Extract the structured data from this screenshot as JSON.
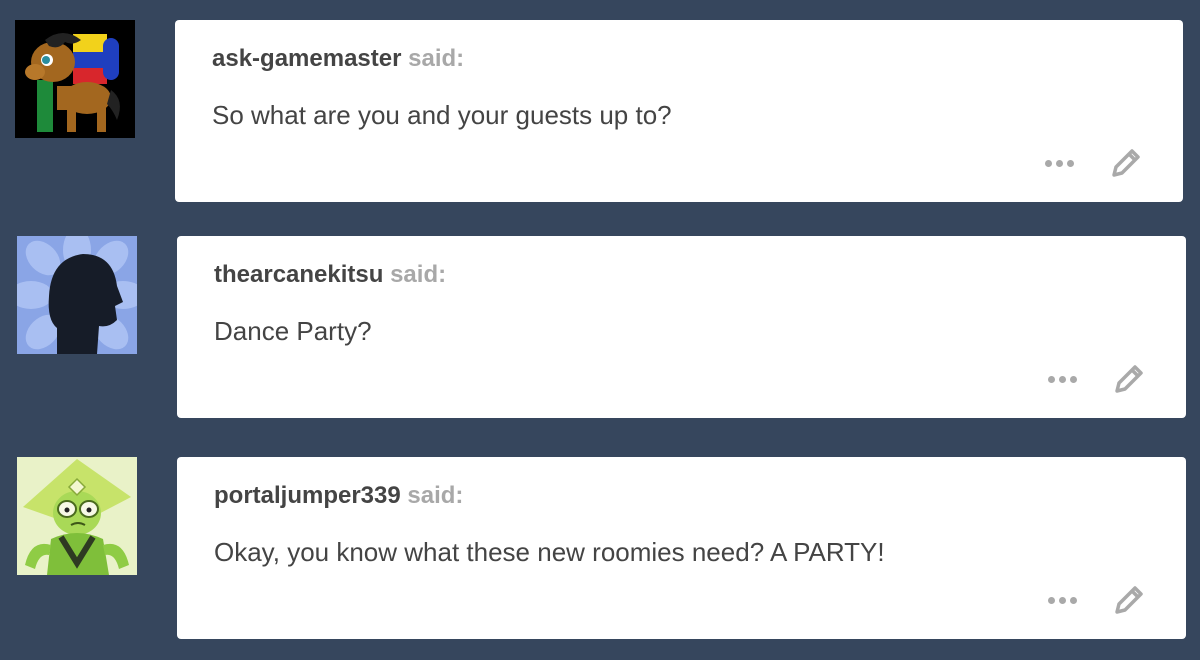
{
  "colors": {
    "background": "#36465d",
    "card": "#ffffff",
    "text": "#444444",
    "said": "#a8a8a8",
    "icon": "#a9a9a9"
  },
  "asks": [
    {
      "asker": "ask-gamemaster",
      "said": "said:",
      "question": "So what are you and your guests up to?",
      "avatar_icon": "pony-avatar",
      "more_icon": "ellipsis-icon",
      "edit_icon": "pencil-icon"
    },
    {
      "asker": "thearcanekitsu",
      "said": "said:",
      "question": "Dance Party?",
      "avatar_icon": "silhouette-avatar",
      "more_icon": "ellipsis-icon",
      "edit_icon": "pencil-icon"
    },
    {
      "asker": "portaljumper339",
      "said": "said:",
      "question": "Okay, you know what these new roomies need? A PARTY!",
      "avatar_icon": "peridot-avatar",
      "more_icon": "ellipsis-icon",
      "edit_icon": "pencil-icon"
    }
  ]
}
